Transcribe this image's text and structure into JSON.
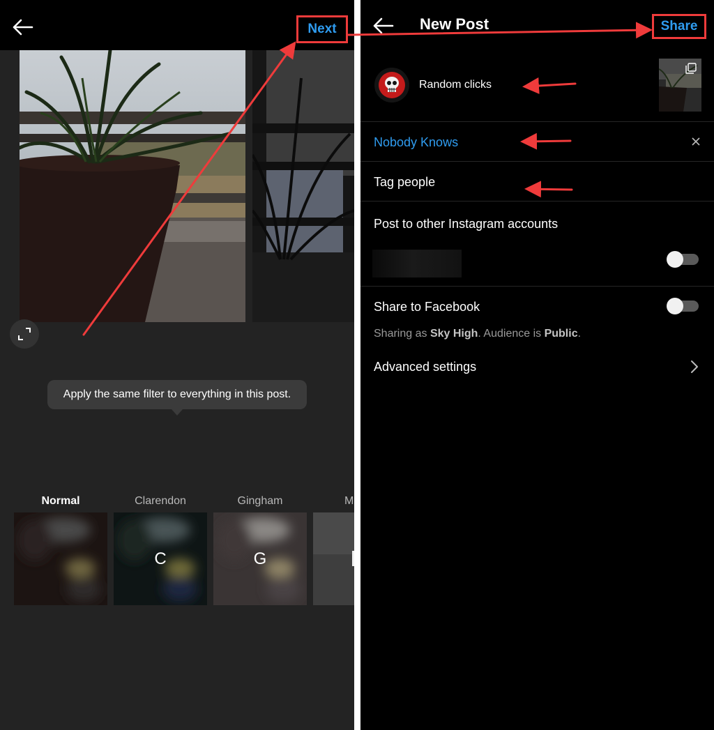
{
  "left_panel": {
    "next_label": "Next",
    "tooltip": "Apply the same filter to everything in this post.",
    "filters": [
      {
        "label": "Normal",
        "letter": "",
        "selected": true
      },
      {
        "label": "Clarendon",
        "letter": "C",
        "selected": false
      },
      {
        "label": "Gingham",
        "letter": "G",
        "selected": false
      },
      {
        "label": "M",
        "letter": "",
        "selected": false
      }
    ]
  },
  "right_panel": {
    "title": "New Post",
    "share_label": "Share",
    "caption": "Random clicks",
    "location": "Nobody Knows",
    "tag_people": "Tag people",
    "other_accounts": "Post to other Instagram accounts",
    "other_accounts_toggle": false,
    "share_facebook": "Share to Facebook",
    "share_facebook_toggle": false,
    "sharing_prefix": "Sharing as ",
    "sharing_name": "Sky High",
    "sharing_mid": ". Audience is ",
    "sharing_audience": "Public",
    "sharing_suffix": ".",
    "advanced": "Advanced settings"
  },
  "colors": {
    "accent": "#2f9cf0",
    "annotation": "#ef3b3b",
    "left_background": "#232323",
    "right_background": "#000000"
  },
  "icons": [
    "back-arrow-icon",
    "expand-icon",
    "close-icon",
    "chevron-right-icon",
    "multi-photo-icon"
  ]
}
